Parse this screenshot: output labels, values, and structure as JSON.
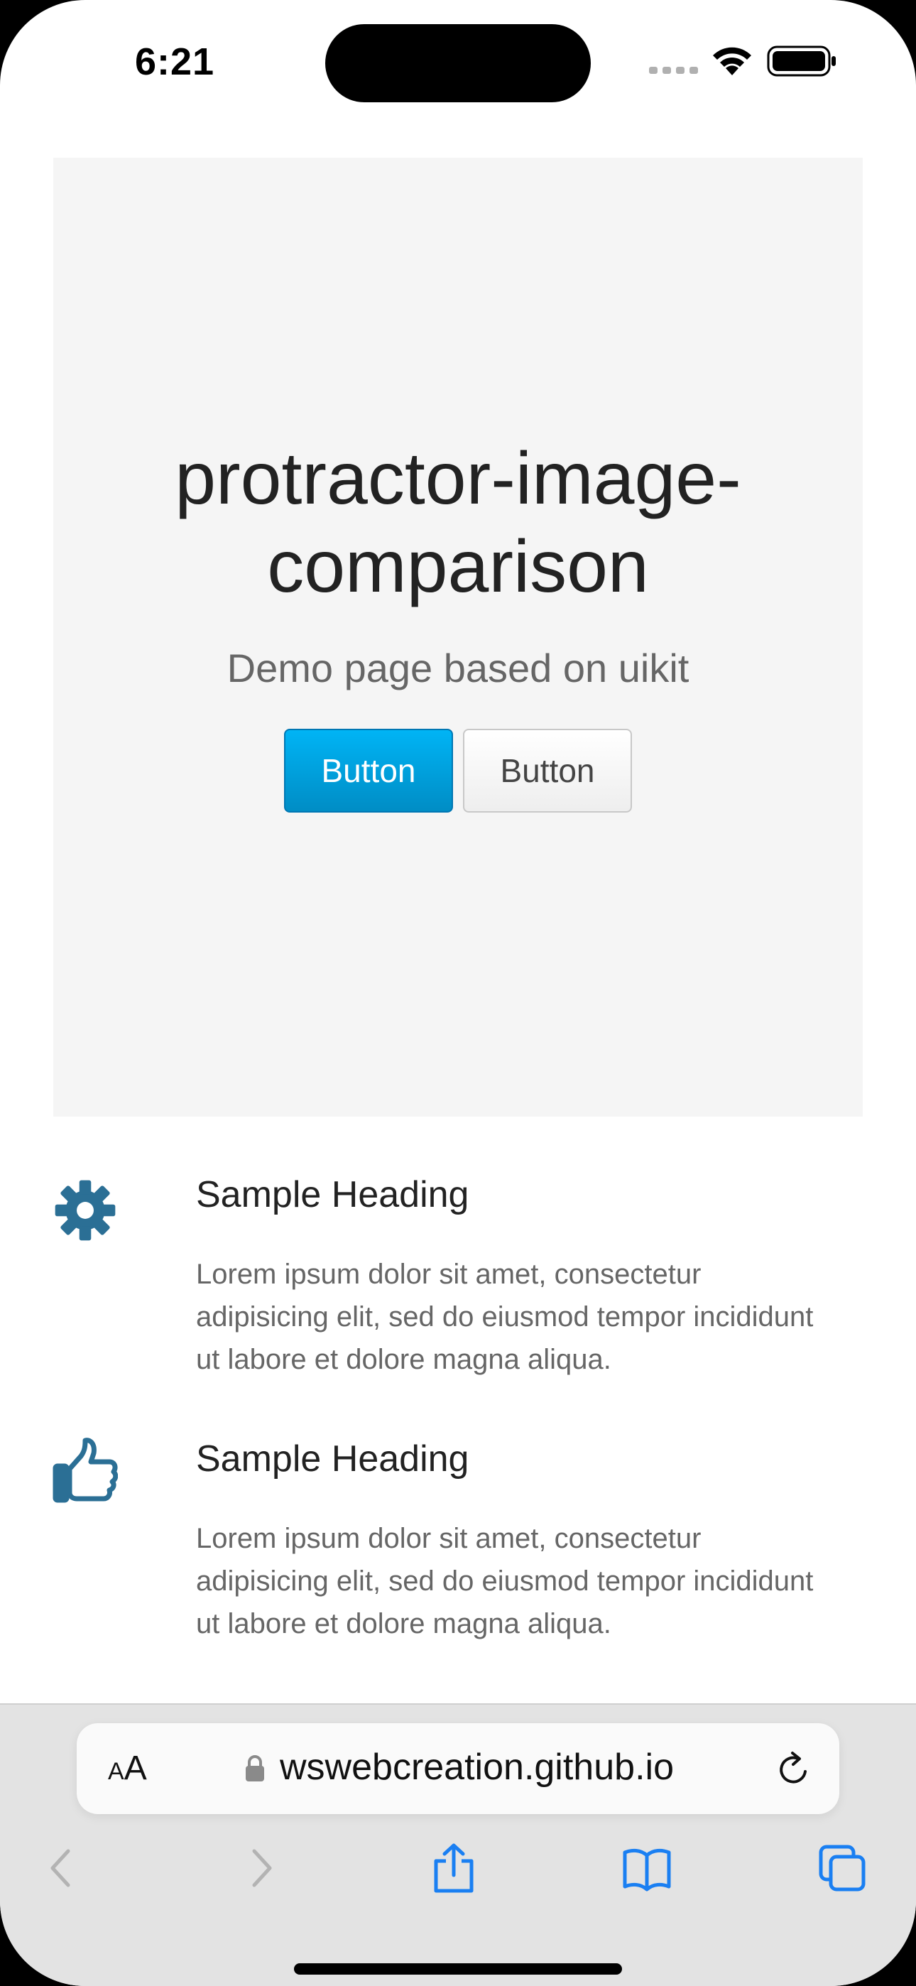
{
  "status_bar": {
    "time": "6:21"
  },
  "hero": {
    "title_line1": "protractor-image-",
    "title_line2": "comparison",
    "subtitle": "Demo page based on uikit",
    "primary_button_label": "Button",
    "secondary_button_label": "Button"
  },
  "features": [
    {
      "icon": "gear-icon",
      "heading": "Sample Heading",
      "text_line1": "Lorem ipsum dolor sit amet, consectetur",
      "text_line2": "adipisicing elit, sed do eiusmod tempor incididunt",
      "text_line3": "ut labore et dolore magna aliqua."
    },
    {
      "icon": "thumbs-up-icon",
      "heading": "Sample Heading",
      "text_line1": "Lorem ipsum dolor sit amet, consectetur",
      "text_line2": "adipisicing elit, sed do eiusmod tempor incididunt",
      "text_line3": "ut labore et dolore magna aliqua."
    }
  ],
  "browser": {
    "reader_small": "A",
    "reader_large": "A",
    "url": "wswebcreation.github.io"
  },
  "colors": {
    "accent": "#00a8e6",
    "icon": "#2b6f95",
    "toolbar_blue": "#1a7ff2"
  }
}
